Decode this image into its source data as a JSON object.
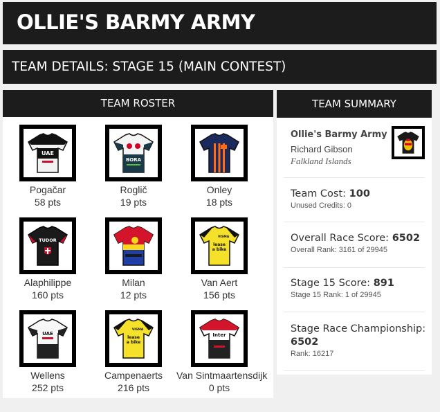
{
  "header": {
    "title": "OLLIE'S BARMY ARMY",
    "subtitle": "TEAM DETAILS: STAGE 15 (MAIN CONTEST)"
  },
  "roster": {
    "heading": "TEAM ROSTER",
    "riders": [
      {
        "name": "Pogačar",
        "pts": "58 pts",
        "jersey": "uae-jersey-icon"
      },
      {
        "name": "Roglič",
        "pts": "19 pts",
        "jersey": "bora-jersey-icon"
      },
      {
        "name": "Onley",
        "pts": "18 pts",
        "jersey": "dsm-jersey-icon"
      },
      {
        "name": "Alaphilippe",
        "pts": "160 pts",
        "jersey": "tudor-jersey-icon"
      },
      {
        "name": "Milan",
        "pts": "12 pts",
        "jersey": "lidl-trek-jersey-icon"
      },
      {
        "name": "Van Aert",
        "pts": "156 pts",
        "jersey": "visma-jersey-icon"
      },
      {
        "name": "Wellens",
        "pts": "252 pts",
        "jersey": "uae-jersey-icon"
      },
      {
        "name": "Campenaerts",
        "pts": "216 pts",
        "jersey": "visma-jersey-icon"
      },
      {
        "name": "Van Sintmaartensdijk",
        "pts": "0 pts",
        "jersey": "intermarche-jersey-icon"
      }
    ]
  },
  "summary": {
    "heading": "TEAM SUMMARY",
    "team_name": "Ollie's Barmy Army",
    "manager": "Richard Gibson",
    "country": "Falkland Islands",
    "team_jersey": "custom-team-jersey-icon",
    "team_cost_label": "Team Cost:",
    "team_cost": "100",
    "unused_credits": "Unused Credits: 0",
    "overall_label": "Overall Race Score:",
    "overall_score": "6502",
    "overall_rank": "Overall Rank: 3161 of 29945",
    "stage_label": "Stage 15 Score:",
    "stage_score": "891",
    "stage_rank": "Stage 15 Rank: 1 of 29945",
    "championship_label": "Stage Race Championship:",
    "championship_score": "6502",
    "championship_rank": "Rank: 16217"
  },
  "colors": {
    "header_bg": "#1c1c1c",
    "page_bg": "#f0f0f0",
    "panel_bg": "#ffffff"
  }
}
